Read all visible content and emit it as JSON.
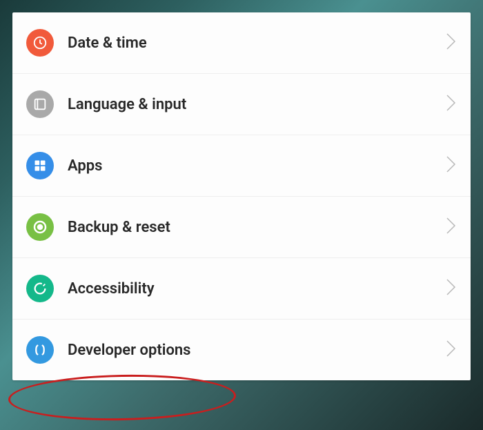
{
  "settings": {
    "items": [
      {
        "label": "Date & time",
        "icon": "clock-icon",
        "iconBg": "#f15a3b"
      },
      {
        "label": "Language & input",
        "icon": "keyboard-icon",
        "iconBg": "#a9a9a9"
      },
      {
        "label": "Apps",
        "icon": "apps-icon",
        "iconBg": "#358ee8"
      },
      {
        "label": "Backup & reset",
        "icon": "backup-icon",
        "iconBg": "#78c044"
      },
      {
        "label": "Accessibility",
        "icon": "accessibility-icon",
        "iconBg": "#14b88a"
      },
      {
        "label": "Developer options",
        "icon": "developer-icon",
        "iconBg": "#3399e0"
      }
    ]
  }
}
